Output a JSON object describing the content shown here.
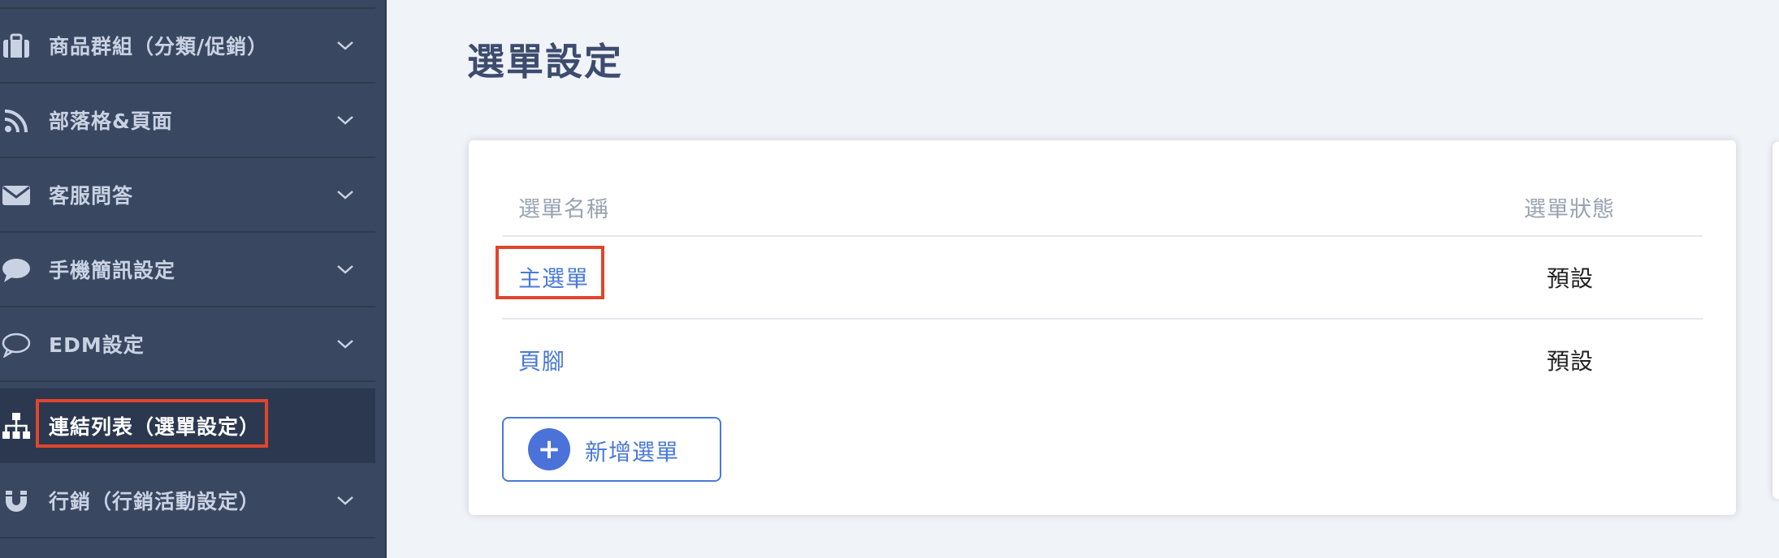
{
  "sidebar": {
    "items": [
      {
        "label": "商品群組（分類/促銷）",
        "icon": "briefcase-icon",
        "expandable": true
      },
      {
        "label": "部落格&頁面",
        "icon": "rss-icon",
        "expandable": true
      },
      {
        "label": "客服問答",
        "icon": "envelope-icon",
        "expandable": true
      },
      {
        "label": "手機簡訊設定",
        "icon": "chat-bubble-icon",
        "expandable": true
      },
      {
        "label": "EDM設定",
        "icon": "chat-outline-icon",
        "expandable": true
      },
      {
        "label": "連結列表（選單設定）",
        "icon": "sitemap-icon",
        "expandable": false,
        "active": true
      },
      {
        "label": "行銷（行銷活動設定）",
        "icon": "magnet-icon",
        "expandable": true
      }
    ]
  },
  "main": {
    "title": "選單設定",
    "table": {
      "columns": [
        "選單名稱",
        "選單狀態"
      ],
      "rows": [
        {
          "name": "主選單",
          "status": "預設"
        },
        {
          "name": "頁腳",
          "status": "預設"
        }
      ]
    },
    "add_button": {
      "icon": "plus-icon",
      "label": "新增選單"
    }
  },
  "colors": {
    "sidebar_bg": "#3a4760",
    "accent": "#4a7ad6",
    "highlight": "#e0452b"
  }
}
